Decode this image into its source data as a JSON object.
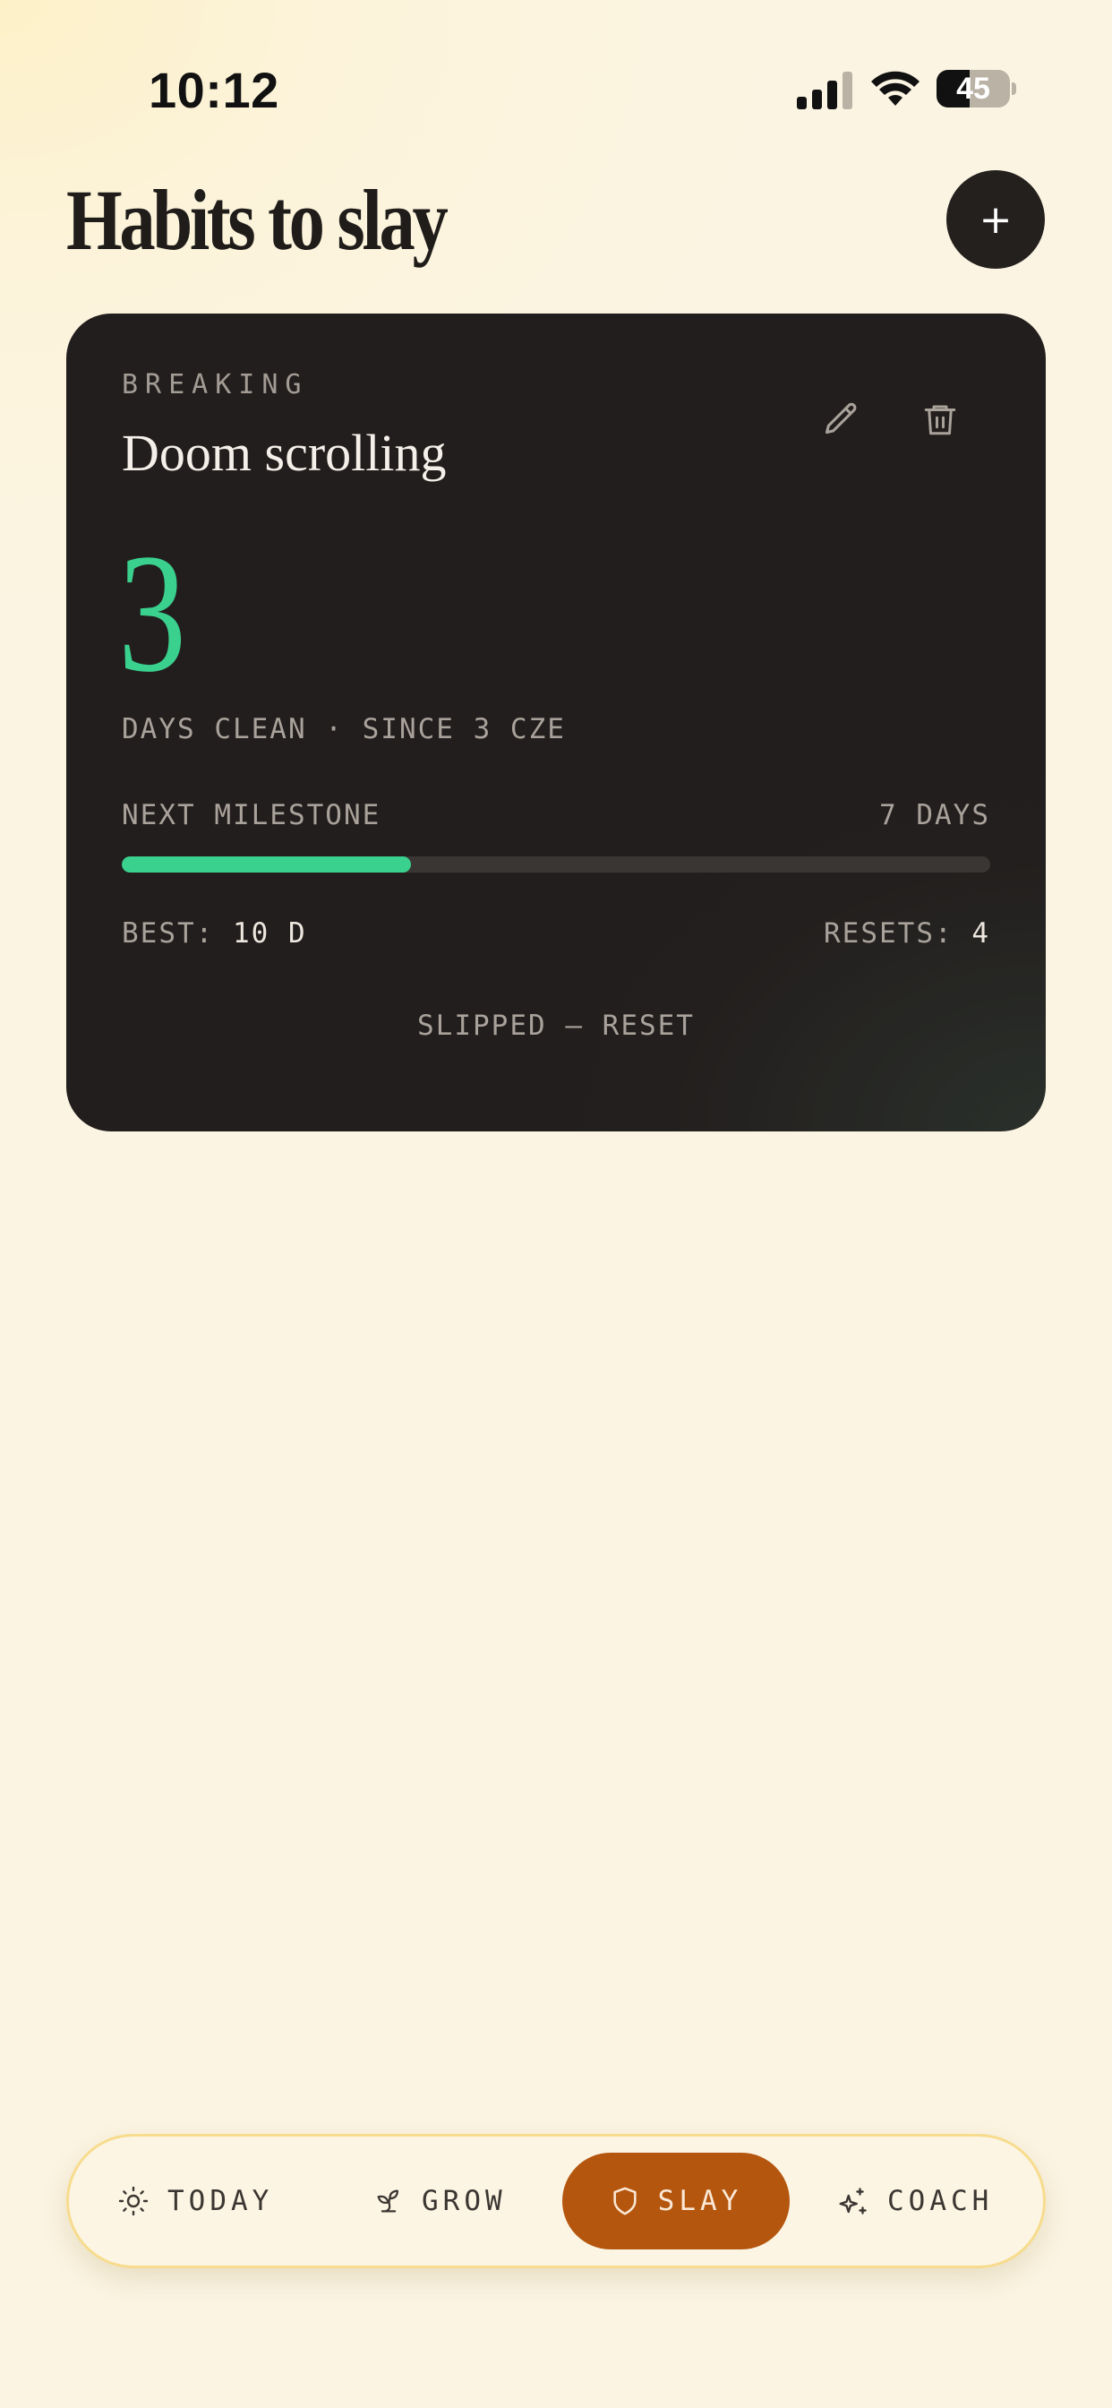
{
  "status_bar": {
    "time": "10:12",
    "battery": "45",
    "battery_level": 0.45
  },
  "header": {
    "title": "Habits to slay",
    "add_label": "+"
  },
  "habit": {
    "category": "BREAKING",
    "name": "Doom scrolling",
    "streak": "3",
    "streak_caption": "DAYS CLEAN · SINCE 3 CZE",
    "milestone_label": "NEXT MILESTONE",
    "milestone_value": "7 DAYS",
    "progress_fraction": 0.333,
    "best_label": "BEST:",
    "best_value": "10 D",
    "resets_label": "RESETS:",
    "resets_value": "4",
    "reset_action": "SLIPPED — RESET",
    "icons": [
      "pencil-icon",
      "trash-icon"
    ]
  },
  "nav": {
    "items": [
      {
        "label": "TODAY",
        "icon": "sun-icon"
      },
      {
        "label": "GROW",
        "icon": "sprout-icon"
      },
      {
        "label": "SLAY",
        "icon": "shield-icon",
        "active": true
      },
      {
        "label": "COACH",
        "icon": "sparkles-icon"
      }
    ]
  },
  "colors": {
    "accent_green": "#3ad08e",
    "active_tab": "#b4560e",
    "card_bg": "#231f1e",
    "page_bg": "#fbf4e2"
  }
}
